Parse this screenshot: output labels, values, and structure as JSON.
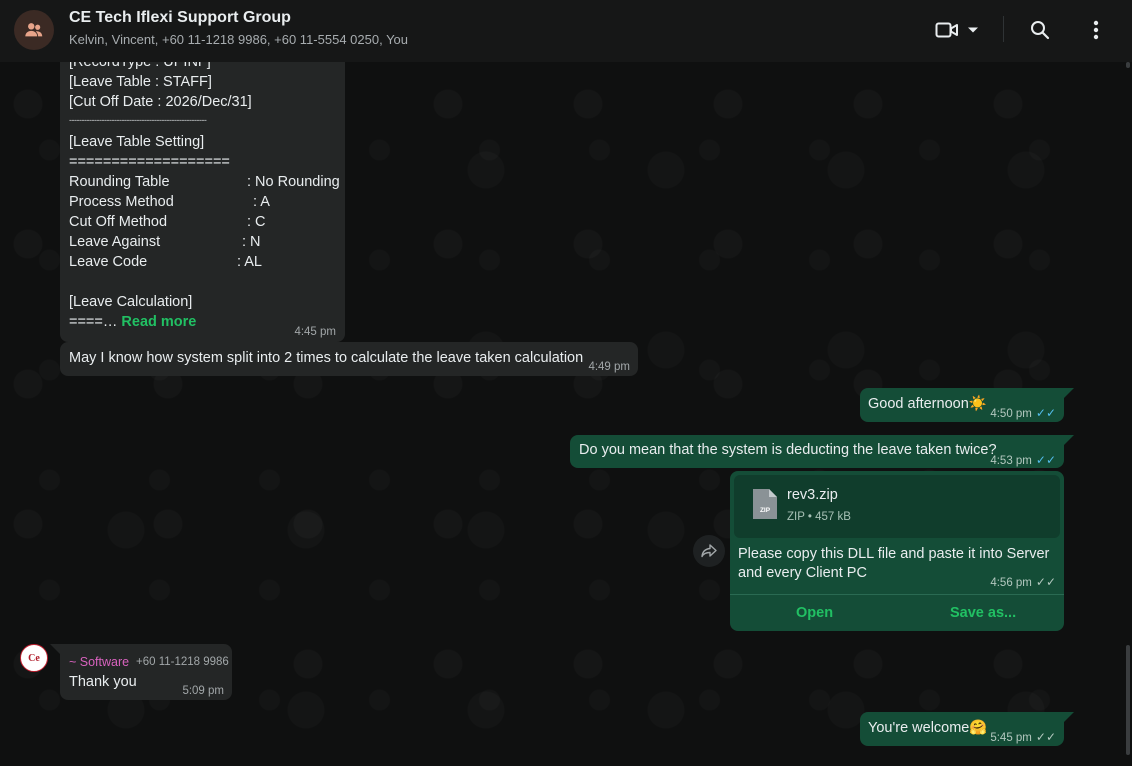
{
  "header": {
    "title": "CE Tech Iflexi Support Group",
    "members": "Kelvin, Vincent, +60 11-1218 9986, +60 11-5554 0250, You"
  },
  "long_message": {
    "lines": [
      "[RecordType : UPINF]",
      "[Leave Table : STAFF]",
      "[Cut Off Date : 2026/Dec/31]",
      "-------------------------------------------------------",
      "[Leave Table Setting]",
      "===================",
      "Rounding Table",
      ": No Rounding",
      "Process Method",
      ": A",
      "Cut Off Method",
      ": C",
      "Leave Against",
      ": N",
      "Leave Code",
      ": AL",
      "[Leave Calculation]",
      "====…"
    ],
    "read_more": "Read more",
    "time": "4:45 pm"
  },
  "messages": {
    "question": {
      "text": "May I know how system split into 2 times to calculate the leave taken calculation",
      "time": "4:49 pm"
    },
    "afternoon": {
      "text": "Good afternoon",
      "emoji": "☀️",
      "time": "4:50 pm"
    },
    "deduct": {
      "text": "Do you mean that the system is deducting the leave taken twice?",
      "time": "4:53 pm"
    },
    "file": {
      "name": "rev3.zip",
      "type": "ZIP",
      "size": "457 kB",
      "icon_label": "ZIP",
      "caption_line1": "Please copy this DLL file and paste it into Server",
      "caption_line2": "and every Client PC",
      "time": "4:56 pm",
      "open": "Open",
      "save": "Save as..."
    },
    "thanks": {
      "sender": "~ Software",
      "phone": "+60 11-1218 9986",
      "text": "Thank you",
      "time": "5:09 pm",
      "avatar_text": "Ce"
    },
    "welcome": {
      "text": "You're welcome",
      "emoji": "🤗",
      "time": "5:45 pm"
    }
  },
  "ticks": "✓✓"
}
